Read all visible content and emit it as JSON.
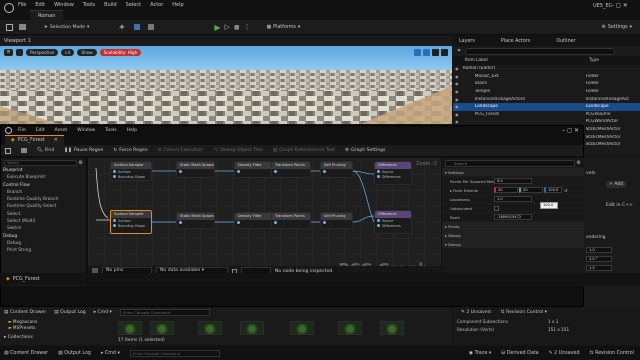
{
  "editor": {
    "menu": [
      "File",
      "Edit",
      "Window",
      "Tools",
      "Build",
      "Select",
      "Actor",
      "Help"
    ],
    "project_tab": "Roman",
    "app_badge": "UE5_EC",
    "selection_mode": "Selection Mode",
    "platforms": "Platforms",
    "settings": "Settings"
  },
  "viewport": {
    "tab": "Viewport 1",
    "perspective": "Perspective",
    "lit": "Lit",
    "show": "Show",
    "scalability": "Scalability: High"
  },
  "outliner": {
    "tabs": [
      "Layers",
      "Place Actors",
      "Outliner"
    ],
    "col_label": "Item Label",
    "col_type": "Type",
    "rows": [
      {
        "label": "Roman (Editor)",
        "type": "",
        "indent": 0,
        "selected": false
      },
      {
        "label": "Mosaic_Ext",
        "type": "Folder",
        "indent": 1,
        "selected": false
      },
      {
        "label": "Stairs",
        "type": "Folder",
        "indent": 1,
        "selected": false
      },
      {
        "label": "Temple",
        "type": "Folder",
        "indent": 1,
        "selected": false
      },
      {
        "label": "InstancedFoliageActor0",
        "type": "InstancedFoliageAct",
        "indent": 1,
        "selected": false
      },
      {
        "label": "Landscape",
        "type": "Landscape",
        "indent": 1,
        "selected": true
      },
      {
        "label": "PCG_Forest",
        "type": "PCGVolume",
        "indent": 1,
        "selected": false
      },
      {
        "label": "",
        "type": "PCGWorldActor",
        "indent": 1,
        "selected": false
      },
      {
        "label": "",
        "type": "StaticMeshActor",
        "indent": 1,
        "selected": false
      },
      {
        "label": "",
        "type": "StaticMeshActor",
        "indent": 1,
        "selected": false
      },
      {
        "label": "",
        "type": "StaticMeshActor",
        "indent": 1,
        "selected": false
      }
    ]
  },
  "pcg": {
    "window_title": "PCG_Forest",
    "menu": [
      "File",
      "Edit",
      "Asset",
      "Window",
      "Tools",
      "Help"
    ],
    "toolbar": [
      "Find",
      "Pause Regen",
      "Force Regen",
      "Cancel Execution",
      "Debug Object Tree",
      "Graph Determinism Test",
      "Graph Settings"
    ],
    "palette_search": "Search",
    "palette": [
      {
        "label": "Blueprint",
        "header": true
      },
      {
        "label": "Execute Blueprint",
        "header": false
      },
      {
        "label": "Control Flow",
        "header": true
      },
      {
        "label": "Branch",
        "header": false
      },
      {
        "label": "Runtime Quality Branch",
        "header": false
      },
      {
        "label": "Runtime Quality Select",
        "header": false
      },
      {
        "label": "Select",
        "header": false
      },
      {
        "label": "Select (Multi)",
        "header": false
      },
      {
        "label": "Switch",
        "header": false
      },
      {
        "label": "Debug",
        "header": true
      },
      {
        "label": "Debug",
        "header": false
      },
      {
        "label": "Print String",
        "header": false
      }
    ],
    "zoom": "Zoom -3",
    "graph_watermark": "PCG Graph",
    "nodes": {
      "surface_sampler": "Surface Sampler",
      "static_mesh_spawner": "Static Mesh Spawner",
      "density_filter": "Density Filter",
      "transform_points": "Transform Points",
      "self_pruning": "Self Pruning",
      "difference": "Difference",
      "pin_surface": "Surface",
      "pin_bounding": "Bounding Shape",
      "pin_source": "Source",
      "pin_differences": "Differences",
      "pin_in": "In",
      "pin_out": "Out"
    },
    "details": {
      "search": "Search",
      "section_settings": "Settings",
      "points_per_sqm_label": "Points Per Squared Meter",
      "points_per_sqm": "9.0",
      "point_extents_label": "Point Extents",
      "extent_x": "20",
      "extent_y": "20",
      "extent_z": "100.0",
      "tooltip": "100.0",
      "looseness_label": "Looseness",
      "looseness": "1.0",
      "unbounded_label": "Unbounded",
      "seed_label": "Seed",
      "seed": "-1809015472",
      "section_points": "Points",
      "section_debug1": "Debug",
      "section_debug2": "Debug"
    },
    "attr_bar": {
      "no_pins": "No pins",
      "no_data": "No data available",
      "no_node": "No node being inspected"
    }
  },
  "right_panel": {
    "levels": "vels",
    "add": "+ Add",
    "edit_cpp": "Edit in C++",
    "rendering": "endering",
    "vals": [
      "1.0",
      "3.0 °",
      "1.0"
    ]
  },
  "bottom": {
    "tab": "PCG_Forest",
    "drawer_tabs": [
      "Content Drawer",
      "Output Log",
      "Cmd"
    ],
    "console_placeholder": "Enter Console Command",
    "folders": [
      "Megascans",
      "MSPresets"
    ],
    "collections": "Collections",
    "item_count": "17 items (1 selected)",
    "unsaved": "2 Unsaved",
    "revision": "Revision Control",
    "outputs": [
      {
        "k": "Component Subsections",
        "v": "1 x 1"
      },
      {
        "k": "Resolution (Verts)",
        "v": "151 x 151"
      }
    ]
  },
  "status": {
    "content_drawer": "Content Drawer",
    "output_log": "Output Log",
    "cmd": "Cmd",
    "console_placeholder": "Enter Console Command",
    "trace": "Trace",
    "derived": "Derived Data",
    "unsaved": "2 Unsaved",
    "revision": "Revision Control"
  },
  "colors": {
    "accent_blue": "#2a6fb5",
    "play_green": "#4caf50",
    "scalability_red": "#c43030",
    "selection_blue": "#1a4c8a",
    "node_orange": "#e28a1a"
  }
}
